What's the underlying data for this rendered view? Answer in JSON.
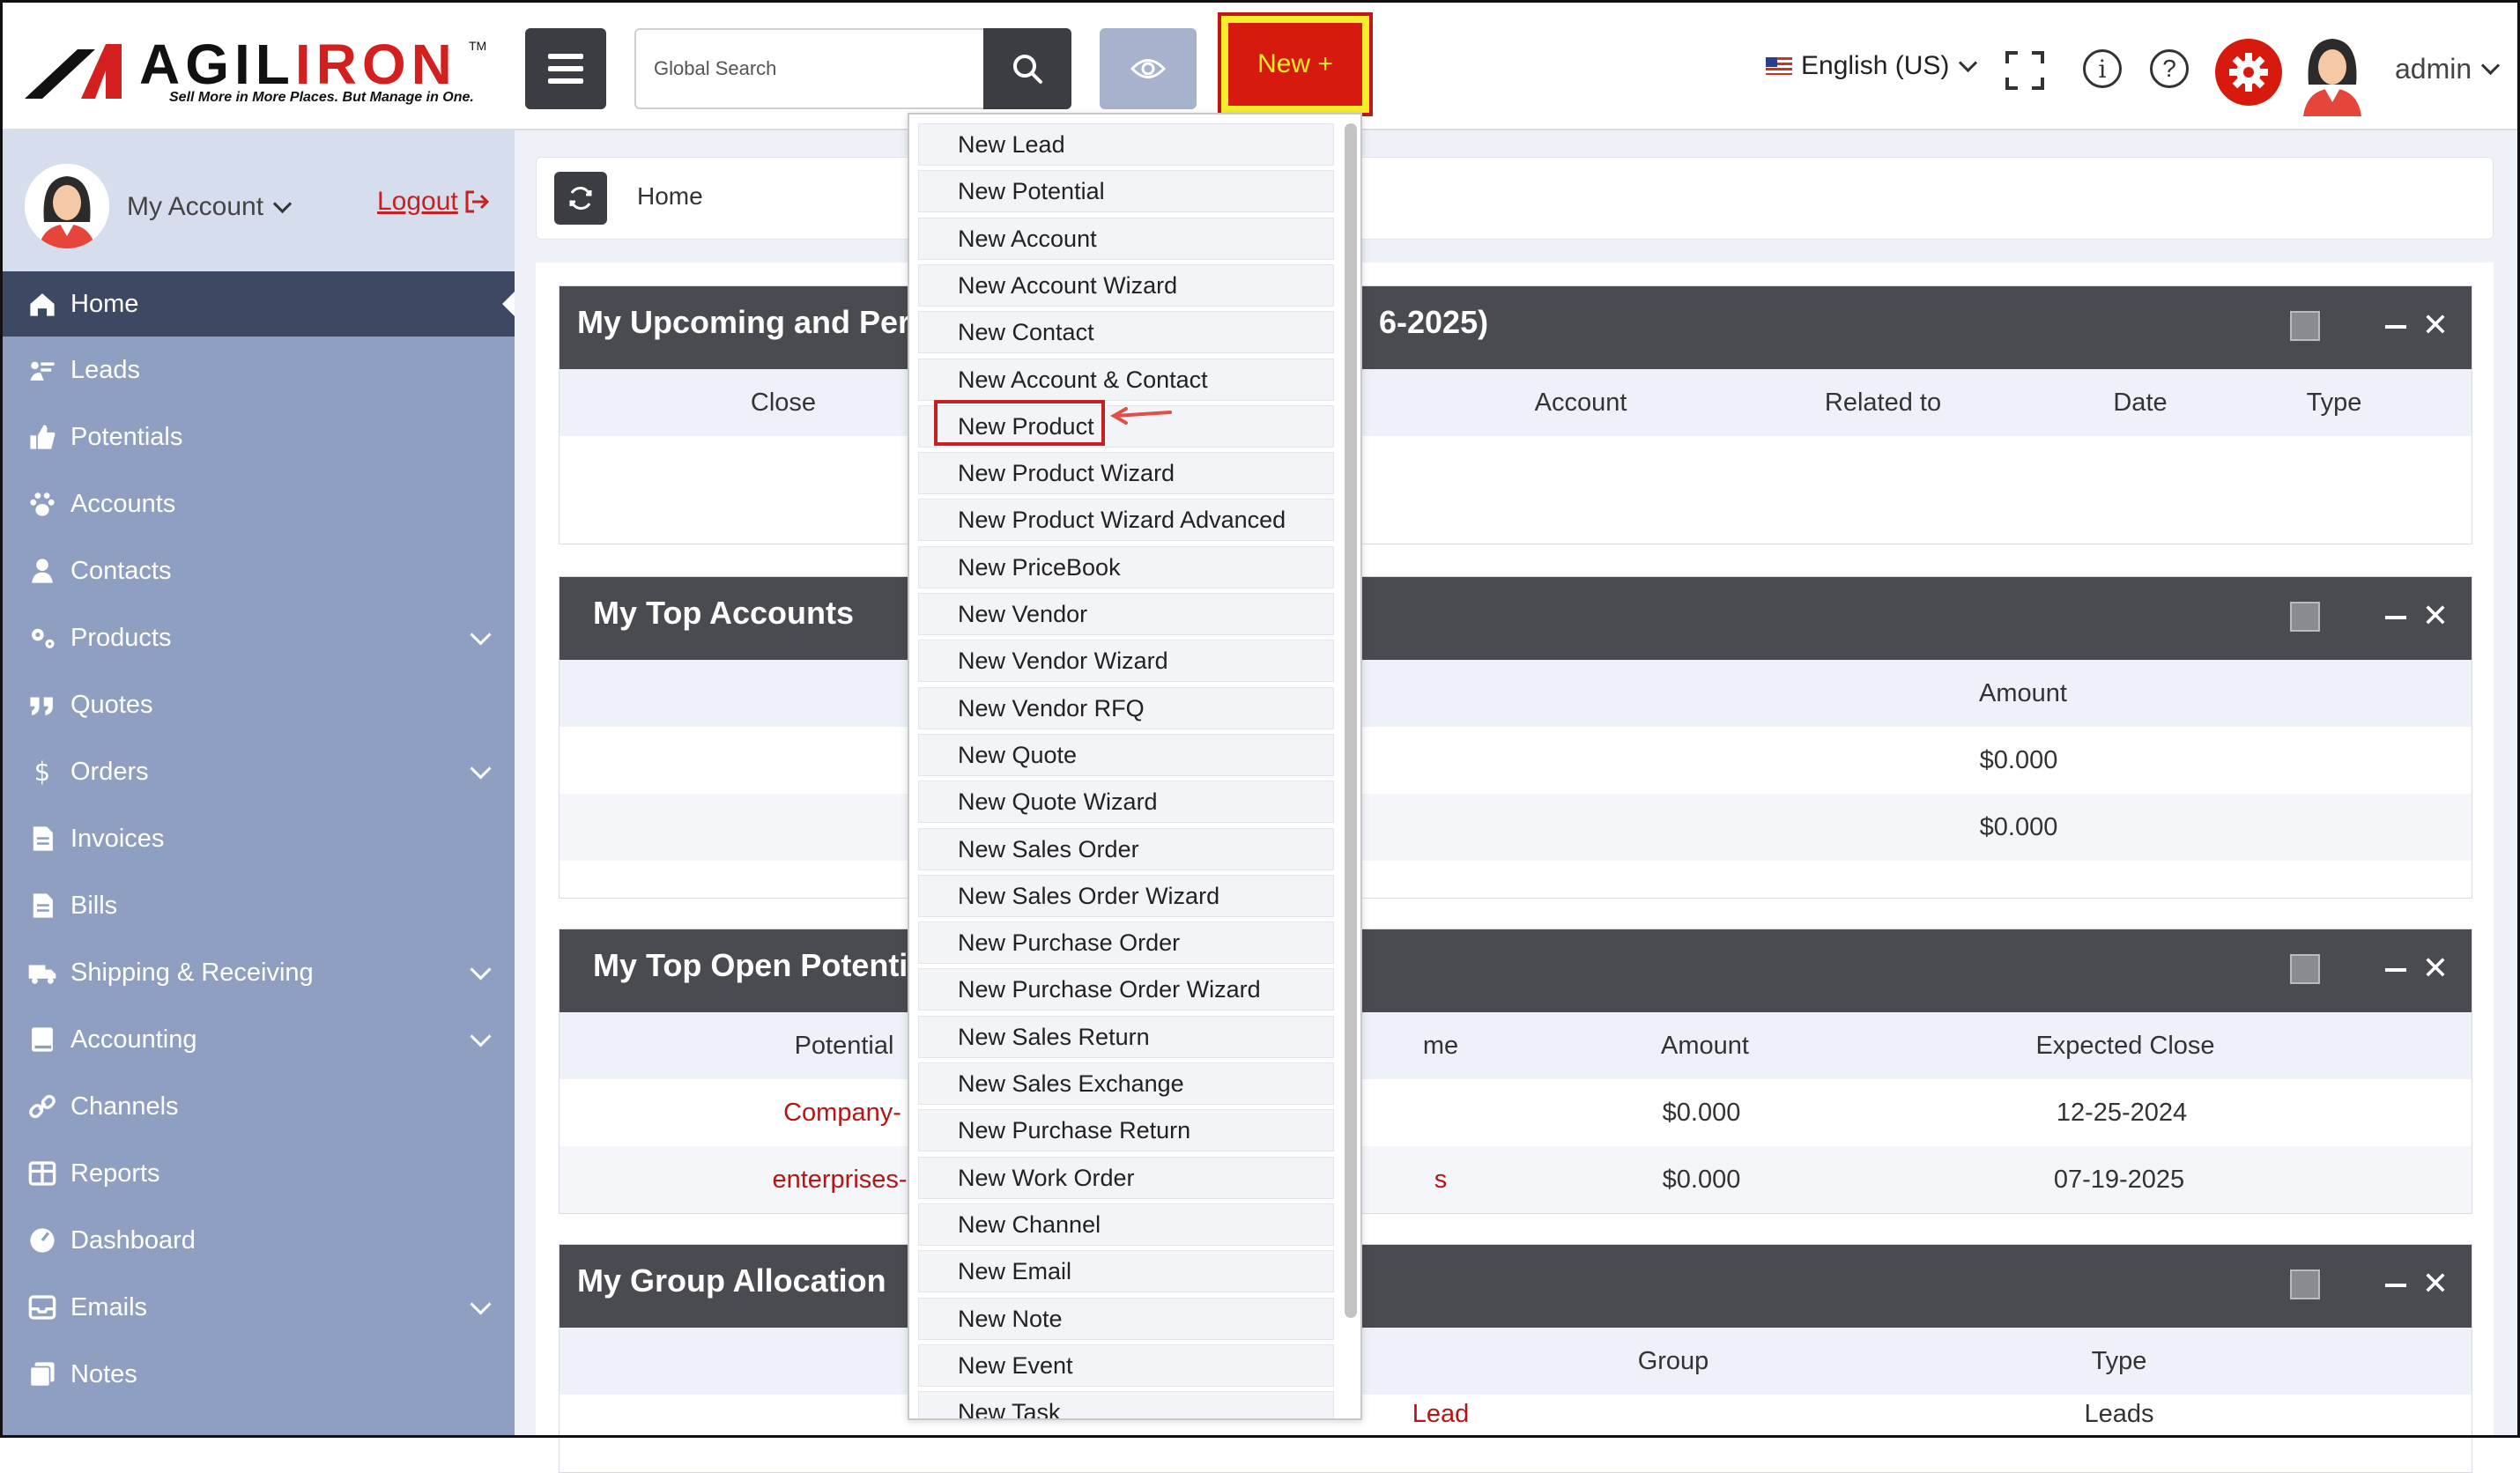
{
  "header": {
    "logo": {
      "name": "AGILIRON",
      "name_red_part": "IRON",
      "name_black_part": "AGIL",
      "tagline": "Sell More in More Places. But Manage in One.",
      "tm": "TM"
    },
    "search": {
      "placeholder": "Global Search"
    },
    "new_button": {
      "label": "New +"
    },
    "language": {
      "label": "English (US)"
    },
    "user": {
      "label": "admin"
    }
  },
  "sidebar": {
    "account_label": "My Account",
    "logout_label": "Logout",
    "items": [
      {
        "label": "Home",
        "icon": "home-icon",
        "active": true,
        "expandable": false
      },
      {
        "label": "Leads",
        "icon": "leads-icon",
        "expandable": false
      },
      {
        "label": "Potentials",
        "icon": "thumbs-up-icon",
        "expandable": false
      },
      {
        "label": "Accounts",
        "icon": "paw-icon",
        "expandable": false
      },
      {
        "label": "Contacts",
        "icon": "user-icon",
        "expandable": false
      },
      {
        "label": "Products",
        "icon": "gears-icon",
        "expandable": true
      },
      {
        "label": "Quotes",
        "icon": "quote-icon",
        "expandable": false
      },
      {
        "label": "Orders",
        "icon": "dollar-icon",
        "expandable": true
      },
      {
        "label": "Invoices",
        "icon": "invoice-icon",
        "expandable": false
      },
      {
        "label": "Bills",
        "icon": "bill-icon",
        "expandable": false
      },
      {
        "label": "Shipping & Receiving",
        "icon": "truck-icon",
        "expandable": true
      },
      {
        "label": "Accounting",
        "icon": "book-icon",
        "expandable": true
      },
      {
        "label": "Channels",
        "icon": "link-icon",
        "expandable": false
      },
      {
        "label": "Reports",
        "icon": "table-icon",
        "expandable": false
      },
      {
        "label": "Dashboard",
        "icon": "gauge-icon",
        "expandable": false
      },
      {
        "label": "Emails",
        "icon": "inbox-icon",
        "expandable": true
      },
      {
        "label": "Notes",
        "icon": "notes-icon",
        "expandable": false
      }
    ]
  },
  "breadcrumb": {
    "home": "Home"
  },
  "widgets": {
    "upcoming": {
      "title_left": "My Upcoming and Per",
      "title_right": "6-2025)",
      "columns": [
        "Close",
        "Account",
        "Related to",
        "Date",
        "Type"
      ]
    },
    "top_accounts": {
      "title": "My Top Accounts",
      "columns": [
        "Amount"
      ],
      "rows": [
        {
          "amount": "$0.000"
        },
        {
          "amount": "$0.000"
        }
      ]
    },
    "top_potentials": {
      "title": "My Top Open Potenti",
      "columns": [
        "Potential",
        "me",
        "Amount",
        "Expected Close"
      ],
      "rows": [
        {
          "potential": "Company-",
          "name_tail": "",
          "amount": "$0.000",
          "close": "12-25-2024"
        },
        {
          "potential": "enterprises-",
          "name_tail": "s",
          "amount": "$0.000",
          "close": "07-19-2025"
        }
      ]
    },
    "group_allocation": {
      "title": "My Group Allocation",
      "columns": [
        "Group",
        "Type"
      ],
      "rows": [
        {
          "name": "Lead",
          "type": "Leads"
        }
      ]
    }
  },
  "new_menu": {
    "items": [
      "New Lead",
      "New Potential",
      "New Account",
      "New Account Wizard",
      "New Contact",
      "New Account & Contact",
      "New Product",
      "New Product Wizard",
      "New Product Wizard Advanced",
      "New PriceBook",
      "New Vendor",
      "New Vendor Wizard",
      "New Vendor RFQ",
      "New Quote",
      "New Quote Wizard",
      "New Sales Order",
      "New Sales Order Wizard",
      "New Purchase Order",
      "New Purchase Order Wizard",
      "New Sales Return",
      "New Sales Exchange",
      "New Purchase Return",
      "New Work Order",
      "New Channel",
      "New Email",
      "New Note",
      "New Event",
      "New Task"
    ],
    "highlighted": "New Product"
  },
  "colors": {
    "sidebar_bg": "#8f9fc2",
    "sidebar_active": "#3d4863",
    "widget_header": "#4a4b50",
    "brand_red": "#d61a0e",
    "highlight_yellow": "#f6ee2a"
  }
}
